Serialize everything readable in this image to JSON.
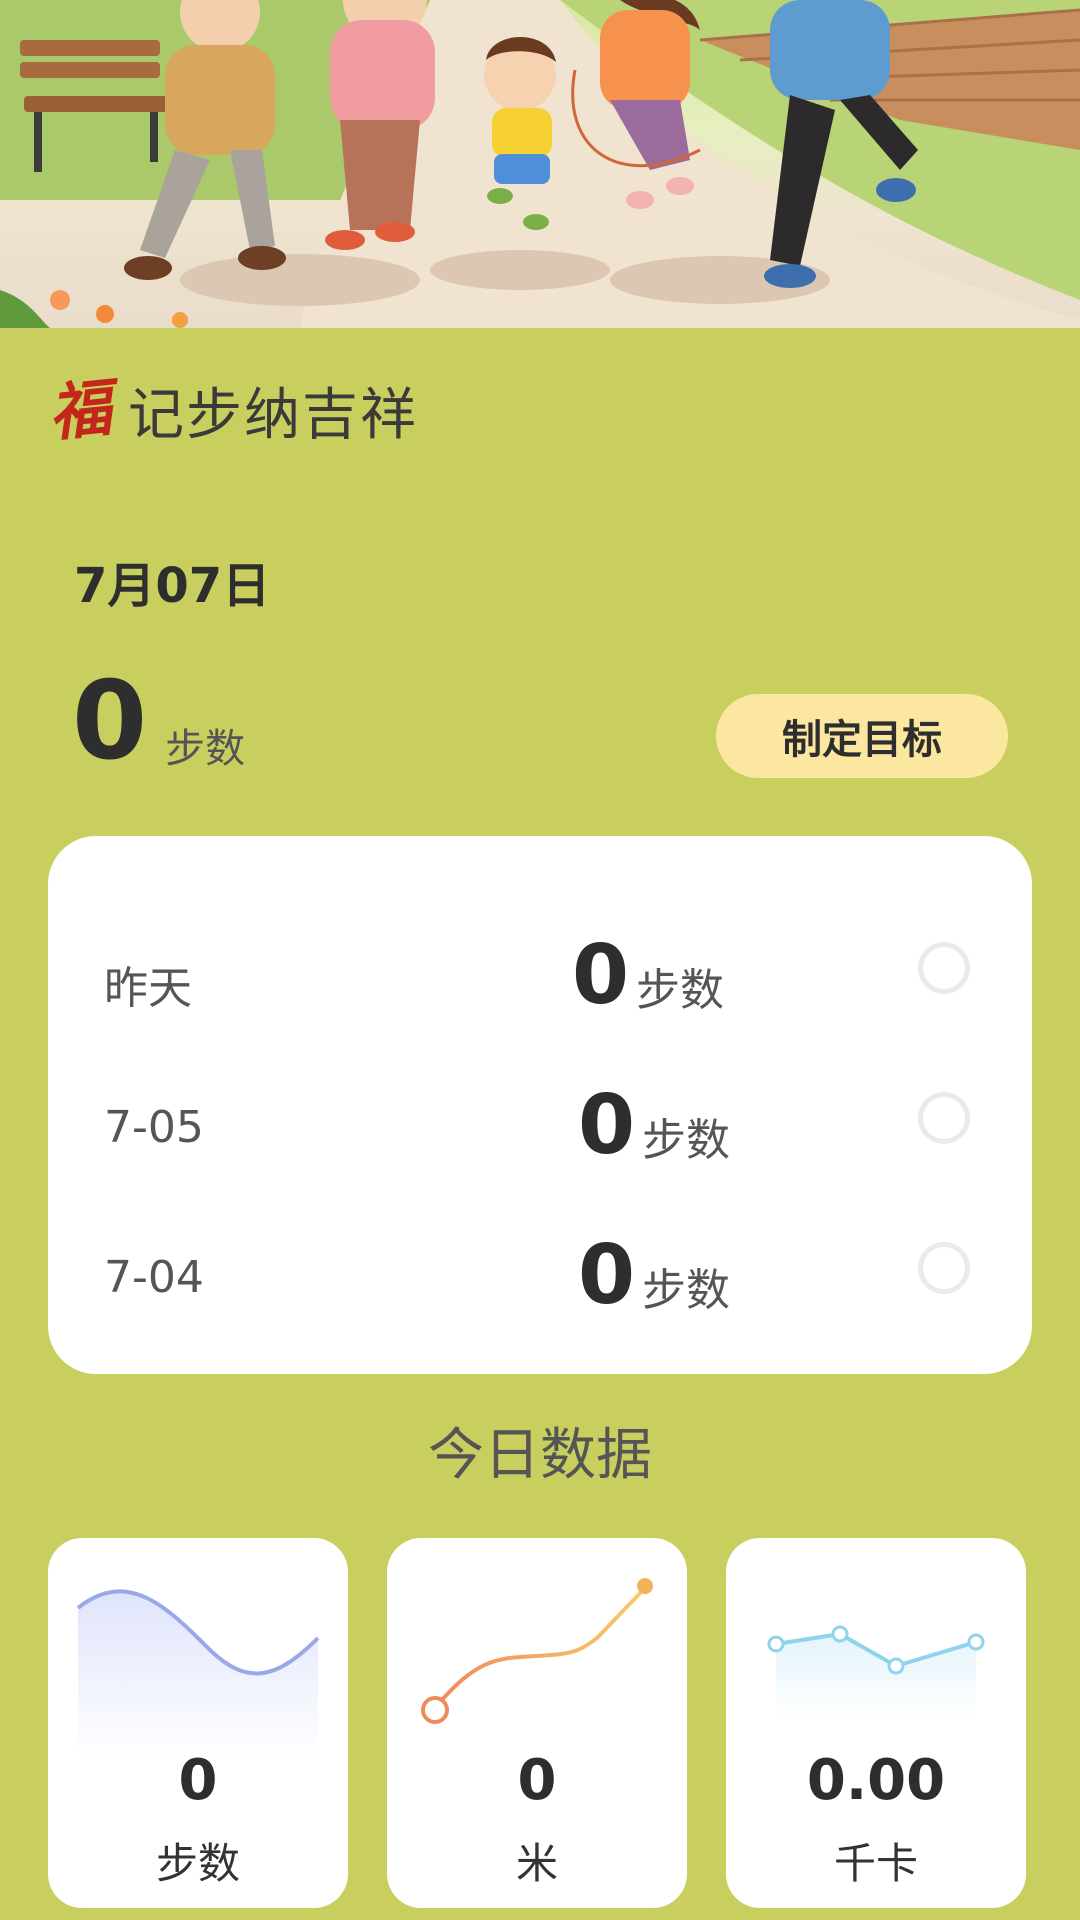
{
  "header": {
    "logo_char": "福",
    "title": "记步纳吉祥"
  },
  "today": {
    "date": "7月07日",
    "steps": "0",
    "unit": "步数"
  },
  "goal_button": "制定目标",
  "history": [
    {
      "label": "昨天",
      "steps": "0",
      "unit": "步数"
    },
    {
      "label": "7-05",
      "steps": "0",
      "unit": "步数"
    },
    {
      "label": "7-04",
      "steps": "0",
      "unit": "步数"
    }
  ],
  "section_title": "今日数据",
  "stats": [
    {
      "value": "0",
      "unit": "步数",
      "color": "#9aa8e8"
    },
    {
      "value": "0",
      "unit": "米",
      "color": "#f0a060"
    },
    {
      "value": "0.00",
      "unit": "千卡",
      "color": "#8fd3ec"
    }
  ],
  "colors": {
    "background": "#c8cf5f",
    "goal_button": "#fbe7a0",
    "logo": "#c3271c"
  }
}
